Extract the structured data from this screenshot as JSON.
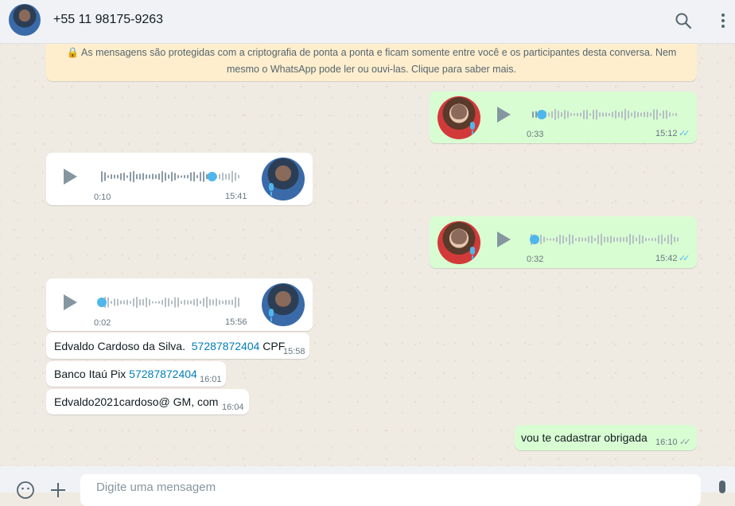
{
  "header": {
    "contact_name": "+55 11 98175-9263",
    "icons": [
      "search-icon",
      "menu-icon"
    ]
  },
  "notice": {
    "line1": "🔒 As mensagens são protegidas com a criptografia de ponta a ponta e ficam somente entre você e os participantes desta conversa. Nem",
    "line2": "mesmo o WhatsApp pode ler ou ouvi-las. Clique para saber mais."
  },
  "messages": [
    {
      "type": "audio",
      "direction": "outgoing",
      "duration": "0:33",
      "time": "15:12",
      "progress": 0.07
    },
    {
      "type": "audio",
      "direction": "incoming",
      "duration": "0:10",
      "time": "15:41",
      "progress": 0.79
    },
    {
      "type": "audio",
      "direction": "outgoing",
      "duration": "0:32",
      "time": "15:42",
      "progress": 0.0
    },
    {
      "type": "audio",
      "direction": "incoming",
      "duration": "0:02",
      "time": "15:56",
      "progress": 0.0
    },
    {
      "type": "text",
      "direction": "incoming",
      "text_before": "Edvaldo Cardoso da Silva.  ",
      "phone": "57287872404",
      "text_after": " CPF",
      "time": "15:58"
    },
    {
      "type": "text",
      "direction": "incoming",
      "text_before": "Banco Itaú Pix ",
      "phone": "57287872404",
      "text_after": "",
      "time": "16:01"
    },
    {
      "type": "text",
      "direction": "incoming",
      "text": "Edvaldo2021cardoso@ GM, com",
      "time": "16:04"
    },
    {
      "type": "text",
      "direction": "outgoing",
      "text": "vou te cadastrar obrigada",
      "time": "16:10"
    }
  ],
  "composer": {
    "placeholder": "Digite uma mensagem",
    "icons": [
      "emoji-icon",
      "attach-icon",
      "mic-icon"
    ]
  },
  "colors": {
    "outgoing_bubble": "#d9fdd3",
    "incoming_bubble": "#ffffff",
    "read_ticks": "#53bdeb",
    "audio_dot": "#4fb6ec",
    "link": "#027eb5"
  }
}
